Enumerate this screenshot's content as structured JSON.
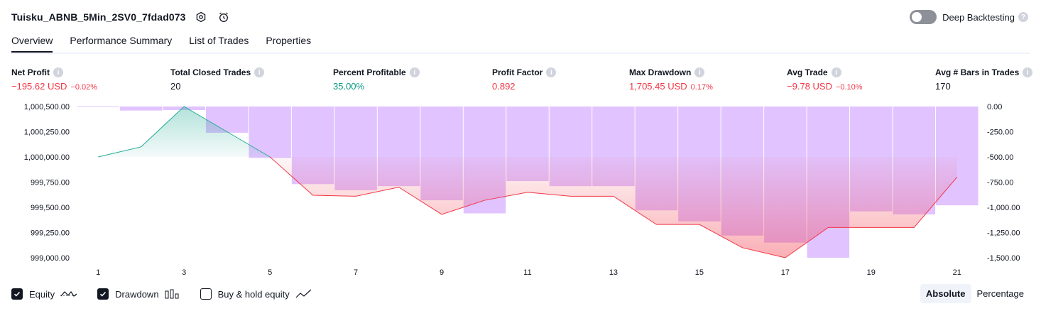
{
  "header": {
    "title": "Tuisku_ABNB_5Min_2SV0_7fdad073",
    "deep_backtesting_label": "Deep Backtesting",
    "help_glyph": "?"
  },
  "tabs": [
    "Overview",
    "Performance Summary",
    "List of Trades",
    "Properties"
  ],
  "stats": [
    {
      "label": "Net Profit",
      "value": "−195.62 USD",
      "pct": "−0.02%",
      "color": "red"
    },
    {
      "label": "Total Closed Trades",
      "value": "20",
      "pct": "",
      "color": "dark"
    },
    {
      "label": "Percent Profitable",
      "value": "35.00%",
      "pct": "",
      "color": "green"
    },
    {
      "label": "Profit Factor",
      "value": "0.892",
      "pct": "",
      "color": "red"
    },
    {
      "label": "Max Drawdown",
      "value": "1,705.45 USD",
      "pct": "0.17%",
      "color": "red"
    },
    {
      "label": "Avg Trade",
      "value": "−9.78 USD",
      "pct": "−0.10%",
      "color": "red"
    },
    {
      "label": "Avg # Bars in Trades",
      "value": "170",
      "pct": "",
      "color": "dark"
    }
  ],
  "colors": {
    "equity_up": "#22ab94",
    "equity_down": "#f23645",
    "drawdown_bar": "#e1c4ff",
    "red": "#f23645",
    "green": "#089981"
  },
  "chart_data": {
    "type": "line",
    "x_ticks": [
      "1",
      "3",
      "5",
      "7",
      "9",
      "11",
      "13",
      "15",
      "17",
      "19",
      "21"
    ],
    "left_axis": {
      "ticks": [
        "1,000,500.00",
        "1,000,250.00",
        "1,000,000.00",
        "999,750.00",
        "999,500.00",
        "999,250.00",
        "999,000.00"
      ],
      "values": [
        1000500,
        1000250,
        1000000,
        999750,
        999500,
        999250,
        999000
      ]
    },
    "right_axis": {
      "ticks": [
        "0.00",
        "-250.00",
        "-500.00",
        "-750.00",
        "-1,000.00",
        "-1,250.00",
        "-1,500.00"
      ],
      "values": [
        0,
        -250,
        -500,
        -750,
        -1000,
        -1250,
        -1500
      ]
    },
    "baseline": 1000000,
    "series": [
      {
        "name": "Equity",
        "type": "line",
        "x": [
          1,
          2,
          3,
          4,
          5,
          6,
          7,
          8,
          9,
          10,
          11,
          12,
          13,
          14,
          15,
          16,
          17,
          18,
          19,
          20,
          21
        ],
        "values": [
          1000000,
          1000100,
          1000500,
          1000250,
          1000000,
          999620,
          999610,
          999700,
          999430,
          999570,
          999650,
          999610,
          999610,
          999330,
          999330,
          999100,
          999000,
          999300,
          999300,
          999300,
          999800
        ]
      },
      {
        "name": "Drawdown",
        "type": "bar",
        "x": [
          1,
          2,
          3,
          4,
          5,
          6,
          7,
          8,
          9,
          10,
          11,
          12,
          13,
          14,
          15,
          16,
          17,
          18,
          19,
          20,
          21
        ],
        "values": [
          -5,
          -40,
          -35,
          -260,
          -510,
          -770,
          -830,
          -790,
          -930,
          -1060,
          -740,
          -790,
          -790,
          -1030,
          -1140,
          -1280,
          -1350,
          -1500,
          -1040,
          -1070,
          -980
        ]
      }
    ]
  },
  "legend": [
    {
      "label": "Equity",
      "checked": true,
      "icon": "equity-line-icon"
    },
    {
      "label": "Drawdown",
      "checked": true,
      "icon": "drawdown-bars-icon"
    },
    {
      "label": "Buy & hold equity",
      "checked": false,
      "icon": "buyhold-line-icon"
    }
  ],
  "modes": [
    "Absolute",
    "Percentage"
  ],
  "selected_mode": "Absolute"
}
